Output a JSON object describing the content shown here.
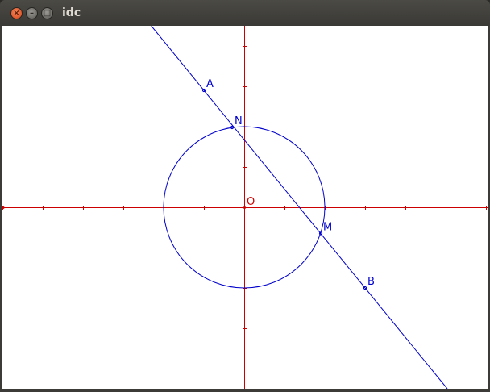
{
  "window": {
    "title": "idc",
    "close_glyph": "×",
    "minimize_glyph": "–",
    "maximize_glyph": "□",
    "close_icon": "close-icon",
    "minimize_icon": "minimize-icon",
    "maximize_icon": "maximize-icon"
  },
  "colors": {
    "axis": "#cc0000",
    "geometry": "#0000cc",
    "canvas_bg": "#ffffff"
  },
  "figure": {
    "origin_label": "O",
    "circle": {
      "center": [
        0,
        0
      ],
      "radius": 2
    },
    "line_points": [
      {
        "label": "A",
        "x": -1,
        "y": 2.9
      },
      {
        "label": "B",
        "x": 3,
        "y": -2
      }
    ],
    "intersections": [
      {
        "label": "N",
        "x": -0.3,
        "y": 1.98
      },
      {
        "label": "M",
        "x": 1.9,
        "y": -0.65
      }
    ],
    "tick_spacing": 1
  }
}
